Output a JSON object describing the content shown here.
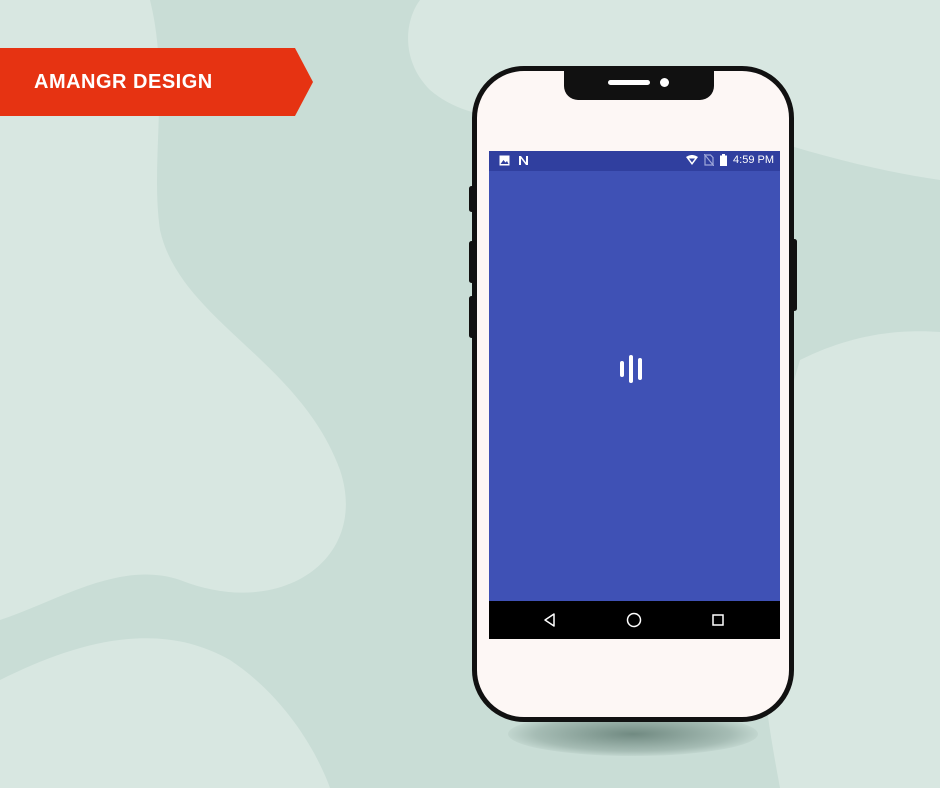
{
  "brand": {
    "label": "AMANGR DESIGN",
    "ribbon_color": "#e63312"
  },
  "colors": {
    "background": "#c9ddd6",
    "background_light": "#d8e7e1",
    "app_primary": "#3f51b5",
    "status_bar": "#303f9f",
    "phone_frame": "#111111",
    "phone_body": "#fdf7f5"
  },
  "phone": {
    "status_bar": {
      "left_icons": [
        "image-icon",
        "n-notification-icon"
      ],
      "right_icons": [
        "wifi-icon",
        "no-sim-icon",
        "battery-icon"
      ],
      "time": "4:59 PM"
    },
    "screen": {
      "loader_icon": "loading-bars-icon"
    },
    "nav_bar": {
      "buttons": [
        "back-triangle-icon",
        "home-circle-icon",
        "recents-square-icon"
      ]
    }
  }
}
